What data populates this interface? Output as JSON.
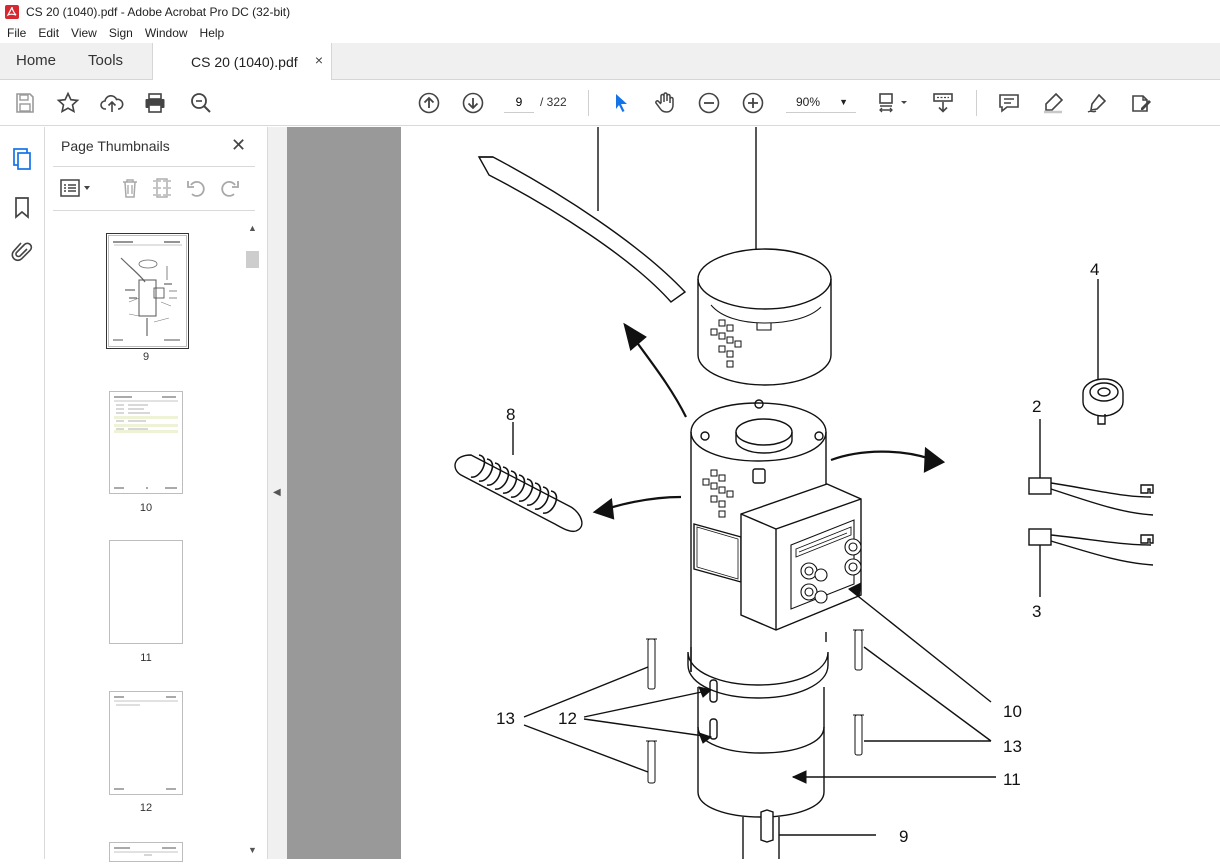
{
  "window": {
    "title": "CS 20 (1040).pdf - Adobe Acrobat Pro DC (32-bit)"
  },
  "menu": {
    "file": "File",
    "edit": "Edit",
    "view": "View",
    "sign": "Sign",
    "window": "Window",
    "help": "Help"
  },
  "tabs": {
    "home": "Home",
    "tools": "Tools",
    "document": "CS 20 (1040).pdf",
    "close": "×"
  },
  "toolbar": {
    "current_page": "9",
    "page_total": "/ 322",
    "zoom": "90%"
  },
  "thumbnails": {
    "title": "Page Thumbnails",
    "close": "✕",
    "pages": [
      {
        "label": "9"
      },
      {
        "label": "10"
      },
      {
        "label": "11"
      },
      {
        "label": "12"
      }
    ]
  },
  "drawing": {
    "callouts": {
      "c2": "2",
      "c3": "3",
      "c4": "4",
      "c8": "8",
      "c9": "9",
      "c10": "10",
      "c11": "11",
      "c12": "12",
      "c13a": "13",
      "c13b": "13"
    }
  },
  "colors": {
    "accent": "#1473e6",
    "doc_background": "#999999"
  }
}
